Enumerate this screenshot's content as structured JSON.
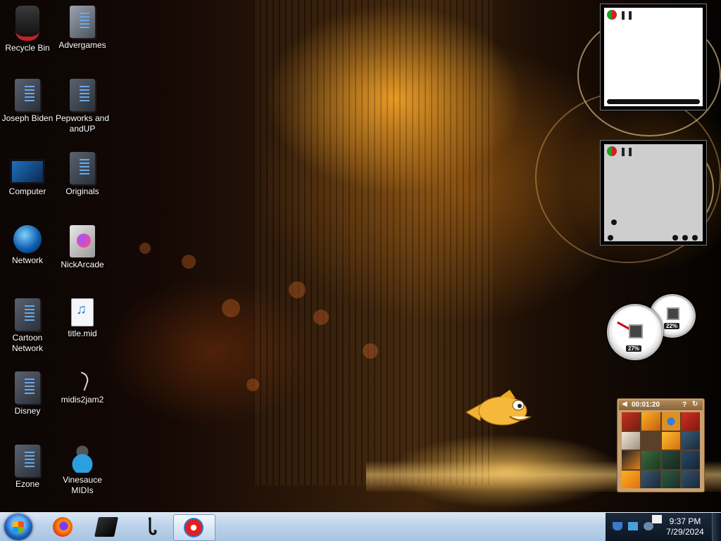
{
  "desktop": {
    "icons": [
      {
        "label": "Recycle Bin",
        "icon": "recycle-bin-icon"
      },
      {
        "label": "Advergames",
        "icon": "folder-icon"
      },
      {
        "label": "Joseph Biden",
        "icon": "user-folder-icon"
      },
      {
        "label": "Pepworks and andUP",
        "icon": "folder-icon"
      },
      {
        "label": "Computer",
        "icon": "computer-icon"
      },
      {
        "label": "Originals",
        "icon": "folder-icon"
      },
      {
        "label": "Network",
        "icon": "network-icon"
      },
      {
        "label": "NickArcade",
        "icon": "folder-icon"
      },
      {
        "label": "Cartoon Network",
        "icon": "folder-icon"
      },
      {
        "label": "title.mid",
        "icon": "midi-file-icon"
      },
      {
        "label": "Disney",
        "icon": "folder-icon"
      },
      {
        "label": "midis2jam2",
        "icon": "app-icon"
      },
      {
        "label": "Ezone",
        "icon": "folder-icon"
      },
      {
        "label": "Vinesauce MIDIs",
        "icon": "user-folder-icon"
      }
    ]
  },
  "gadgets": {
    "cpu_meter": {
      "cpu_percent": "27%",
      "memory_percent": "22%",
      "cpu_level": 0.27,
      "memory_level": 0.22
    },
    "puzzle": {
      "timer": "00:01:20",
      "help": "?"
    }
  },
  "taskbar": {
    "pinned": [
      {
        "name": "firefox",
        "icon": "firefox-icon"
      },
      {
        "name": "device",
        "icon": "black-box-icon"
      },
      {
        "name": "saxophone",
        "icon": "saxophone-icon"
      },
      {
        "name": "flash",
        "icon": "flash-icon",
        "active": true
      }
    ],
    "tray_icons": [
      "shield-icon",
      "folder-icon",
      "network-icon",
      "flag-icon"
    ],
    "clock": {
      "time": "9:37 PM",
      "date": "7/29/2024"
    }
  },
  "colors": {
    "taskbar": "#bcd2ea",
    "tray": "#0c1622",
    "gauge_needle": "#cc0000"
  }
}
